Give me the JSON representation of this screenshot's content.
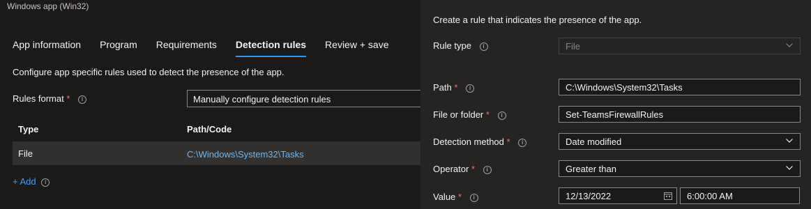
{
  "window_title": "Windows app (Win32)",
  "tabs": [
    {
      "label": "App information"
    },
    {
      "label": "Program"
    },
    {
      "label": "Requirements"
    },
    {
      "label": "Detection rules"
    },
    {
      "label": "Review + save"
    }
  ],
  "description": "Configure app specific rules used to detect the presence of the app.",
  "rules_format": {
    "label": "Rules format",
    "required_mark": "*",
    "value": "Manually configure detection rules"
  },
  "table": {
    "headers": [
      "Type",
      "Path/Code"
    ],
    "rows": [
      {
        "type": "File",
        "path": "C:\\Windows\\System32\\Tasks"
      }
    ]
  },
  "add_label": "+ Add",
  "panel": {
    "intro": "Create a rule that indicates the presence of the app.",
    "rule_type": {
      "label": "Rule type",
      "value": "File"
    },
    "path": {
      "label": "Path",
      "required_mark": "*",
      "value": "C:\\Windows\\System32\\Tasks"
    },
    "file_or_folder": {
      "label": "File or folder",
      "required_mark": "*",
      "value": "Set-TeamsFirewallRules"
    },
    "detection_method": {
      "label": "Detection method",
      "required_mark": "*",
      "value": "Date modified"
    },
    "operator": {
      "label": "Operator",
      "required_mark": "*",
      "value": "Greater than"
    },
    "value": {
      "label": "Value",
      "required_mark": "*",
      "date": "12/13/2022",
      "time": "6:00:00 AM"
    }
  },
  "colors": {
    "accent": "#2899f5",
    "link": "#6cb8f6",
    "required": "#f1707b"
  }
}
